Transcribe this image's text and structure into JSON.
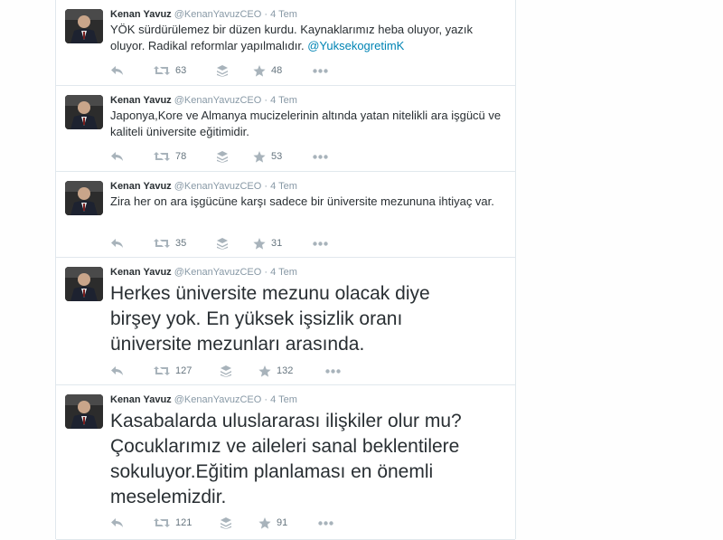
{
  "tweets": [
    {
      "fullname": "Kenan Yavuz",
      "username": "@KenanYavuzCEO",
      "separator": "·",
      "time": "4 Tem",
      "text": "YÖK sürdürülemez bir düzen kurdu. Kaynaklarımız heba oluyor, yazık oluyor. Radikal reformlar yapılmalıdır.",
      "mention": "@YuksekogretimK",
      "retweets": "63",
      "favorites": "48"
    },
    {
      "fullname": "Kenan Yavuz",
      "username": "@KenanYavuzCEO",
      "separator": "·",
      "time": "4 Tem",
      "text": "Japonya,Kore ve Almanya mucizelerinin altında yatan nitelikli ara işgücü ve kaliteli üniversite eğitimidir.",
      "retweets": "78",
      "favorites": "53"
    },
    {
      "fullname": "Kenan Yavuz",
      "username": "@KenanYavuzCEO",
      "separator": "·",
      "time": "4 Tem",
      "text": "Zira her on ara işgücüne karşı sadece bir üniversite mezununa ihtiyaç var.",
      "retweets": "35",
      "favorites": "31"
    },
    {
      "fullname": "Kenan Yavuz",
      "username": "@KenanYavuzCEO",
      "separator": "·",
      "time": "4 Tem",
      "text": "Herkes üniversite mezunu olacak diye birşey yok. En yüksek işsizlik oranı üniversite mezunları arasında.",
      "retweets": "127",
      "favorites": "132"
    },
    {
      "fullname": "Kenan Yavuz",
      "username": "@KenanYavuzCEO",
      "separator": "·",
      "time": "4 Tem",
      "text": "Kasabalarda uluslararası ilişkiler olur mu? Çocuklarımız ve aileleri sanal beklentilere sokuluyor.Eğitim planlaması en önemli meselemizdir.",
      "retweets": "121",
      "favorites": "91"
    }
  ],
  "icons": {
    "reply": "reply-icon",
    "retweet": "retweet-icon",
    "stack": "stack-icon",
    "favorite": "star-icon",
    "more": "more-icon"
  },
  "colors": {
    "name": "#292f33",
    "meta": "#8899a6",
    "link": "#0084b4",
    "border": "#e1e8ed"
  }
}
